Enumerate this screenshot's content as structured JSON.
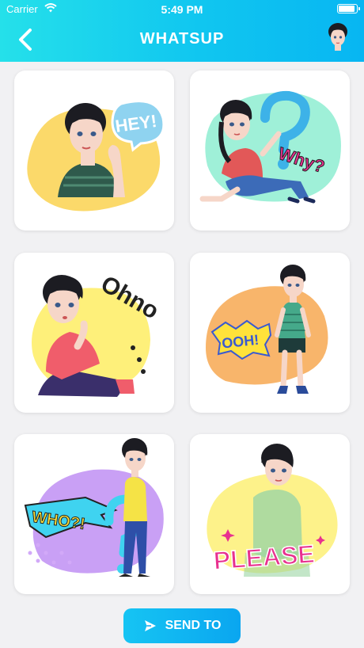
{
  "status_bar": {
    "carrier": "Carrier",
    "time": "5:49 PM",
    "battery_level": 1.0
  },
  "header": {
    "title": "WHATSUP"
  },
  "stickers": [
    {
      "caption": "HEY!",
      "blob_color": "#fbd96a",
      "accent": "#8fd3f0"
    },
    {
      "caption": "Why?",
      "blob_color": "#9ff0d8",
      "accent": "#3db2e8"
    },
    {
      "caption": "Ohno",
      "blob_color": "#fef07a",
      "accent": "#222222"
    },
    {
      "caption": "OOH!",
      "blob_color": "#f8b56b",
      "accent": "#ffe23a"
    },
    {
      "caption": "WHO?!",
      "blob_color": "#c9a0f5",
      "accent": "#3fd3f0"
    },
    {
      "caption": "PLEASE",
      "blob_color": "#fdf28a",
      "accent": "#e8318f"
    }
  ],
  "send_button": {
    "label": "SEND TO"
  },
  "colors": {
    "header_start": "#25e0ea",
    "header_end": "#08b6f2",
    "button": "#0aa6f0"
  }
}
